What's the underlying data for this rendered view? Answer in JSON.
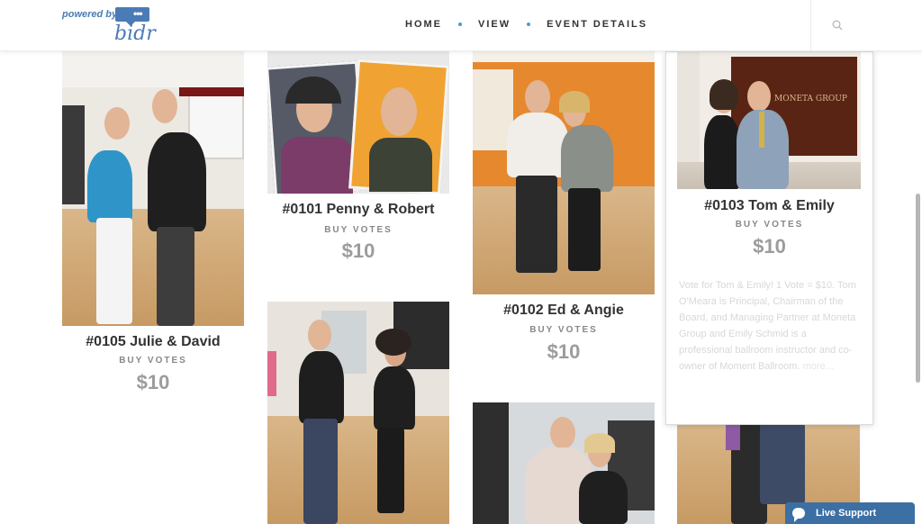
{
  "header": {
    "logo_powered": "powered by",
    "logo_brand": "bidr",
    "logo_dots": "•••",
    "nav": [
      "HOME",
      "VIEW",
      "EVENT DETAILS"
    ]
  },
  "items": [
    {
      "title": "#0105 Julie & David",
      "buy": "BUY VOTES",
      "price": "$10"
    },
    {
      "title": "#0101 Penny & Robert",
      "buy": "BUY VOTES",
      "price": "$10"
    },
    {
      "title": "#0102 Ed & Angie",
      "buy": "BUY VOTES",
      "price": "$10"
    },
    {
      "title": "#0103 Tom & Emily",
      "buy": "BUY VOTES",
      "price": "$10",
      "description": "Vote for Tom & Emily! 1 Vote = $10. Tom O'Meara is Principal, Chairman of the Board, and Managing Partner at Moneta Group and Emily Schmid is a professional ballroom instructor and co-owner of Moment Ballroom.",
      "more": "more..."
    }
  ],
  "photo_sign": "MONETA GROUP",
  "live_support": "Live Support"
}
